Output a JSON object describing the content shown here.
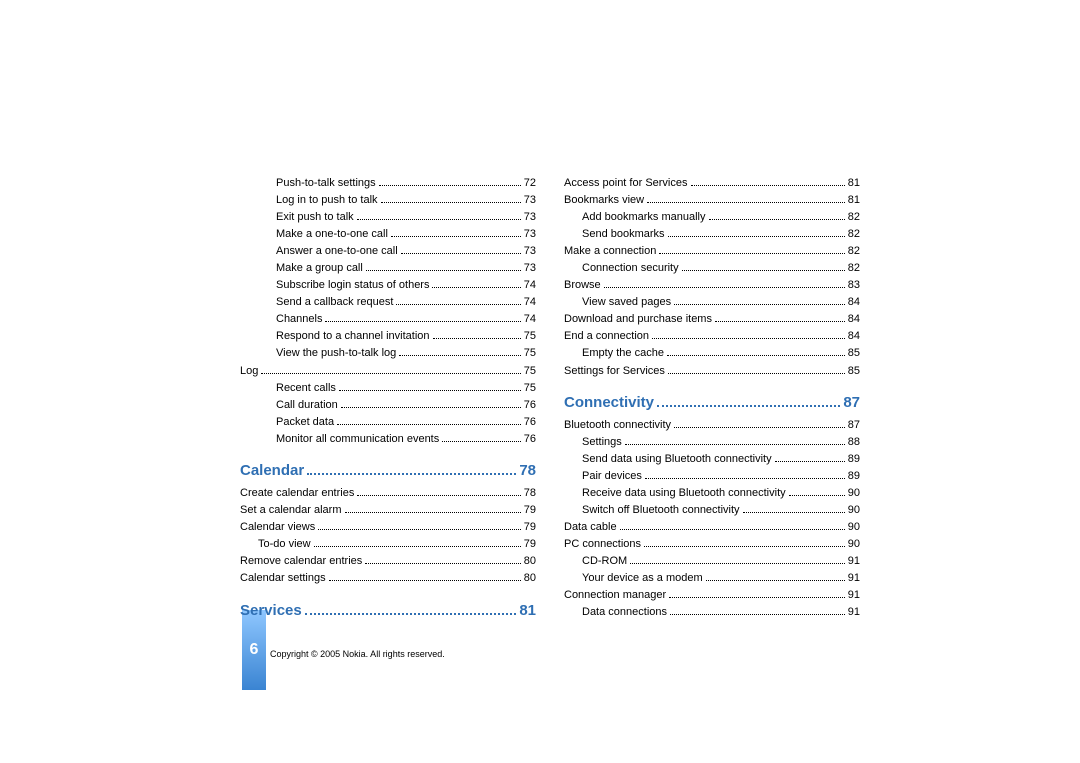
{
  "page_number": "6",
  "copyright": "Copyright © 2005 Nokia. All rights reserved.",
  "left_col": [
    {
      "t": "Push-to-talk settings",
      "p": "72",
      "i": 2
    },
    {
      "t": "Log in to push to talk",
      "p": "73",
      "i": 2
    },
    {
      "t": "Exit push to talk",
      "p": "73",
      "i": 2
    },
    {
      "t": "Make a one-to-one call",
      "p": "73",
      "i": 2
    },
    {
      "t": "Answer a one-to-one call",
      "p": "73",
      "i": 2
    },
    {
      "t": "Make a group call",
      "p": "73",
      "i": 2
    },
    {
      "t": "Subscribe login status of others",
      "p": "74",
      "i": 2
    },
    {
      "t": "Send a callback request",
      "p": "74",
      "i": 2
    },
    {
      "t": "Channels",
      "p": "74",
      "i": 2
    },
    {
      "t": "Respond to a channel invitation",
      "p": "75",
      "i": 2
    },
    {
      "t": "View the push-to-talk log",
      "p": "75",
      "i": 2
    },
    {
      "t": "Log",
      "p": "75",
      "i": 0
    },
    {
      "t": "Recent calls",
      "p": "75",
      "i": 2
    },
    {
      "t": "Call duration",
      "p": "76",
      "i": 2
    },
    {
      "t": "Packet data",
      "p": "76",
      "i": 2
    },
    {
      "t": "Monitor all communication events",
      "p": "76",
      "i": 2
    },
    {
      "section": true,
      "t": "Calendar",
      "p": "78"
    },
    {
      "t": "Create calendar entries",
      "p": "78",
      "i": 0
    },
    {
      "t": "Set a calendar alarm",
      "p": "79",
      "i": 0
    },
    {
      "t": "Calendar views",
      "p": "79",
      "i": 0
    },
    {
      "t": "To-do view",
      "p": "79",
      "i": 1
    },
    {
      "t": "Remove calendar entries",
      "p": "80",
      "i": 0
    },
    {
      "t": "Calendar settings",
      "p": "80",
      "i": 0
    },
    {
      "section": true,
      "t": "Services",
      "p": "81"
    }
  ],
  "right_col": [
    {
      "t": "Access point for Services",
      "p": "81",
      "i": 0
    },
    {
      "t": "Bookmarks view",
      "p": "81",
      "i": 0
    },
    {
      "t": "Add bookmarks manually",
      "p": "82",
      "i": 1
    },
    {
      "t": "Send bookmarks",
      "p": "82",
      "i": 1
    },
    {
      "t": "Make a connection",
      "p": "82",
      "i": 0
    },
    {
      "t": "Connection security",
      "p": "82",
      "i": 1
    },
    {
      "t": "Browse",
      "p": "83",
      "i": 0
    },
    {
      "t": "View saved pages",
      "p": "84",
      "i": 1
    },
    {
      "t": "Download and purchase items",
      "p": "84",
      "i": 0
    },
    {
      "t": "End a connection",
      "p": "84",
      "i": 0
    },
    {
      "t": "Empty the cache",
      "p": "85",
      "i": 1
    },
    {
      "t": "Settings for Services",
      "p": "85",
      "i": 0
    },
    {
      "section": true,
      "t": "Connectivity",
      "p": "87"
    },
    {
      "t": "Bluetooth connectivity",
      "p": "87",
      "i": 0
    },
    {
      "t": "Settings",
      "p": "88",
      "i": 1
    },
    {
      "t": "Send data using Bluetooth connectivity",
      "p": "89",
      "i": 1
    },
    {
      "t": "Pair devices",
      "p": "89",
      "i": 1
    },
    {
      "t": "Receive data using Bluetooth connectivity",
      "p": "90",
      "i": 1
    },
    {
      "t": "Switch off Bluetooth connectivity",
      "p": "90",
      "i": 1
    },
    {
      "t": "Data cable",
      "p": "90",
      "i": 0
    },
    {
      "t": "PC connections",
      "p": "90",
      "i": 0
    },
    {
      "t": "CD-ROM",
      "p": "91",
      "i": 1
    },
    {
      "t": "Your device as a modem",
      "p": "91",
      "i": 1
    },
    {
      "t": "Connection manager",
      "p": "91",
      "i": 0
    },
    {
      "t": "Data connections",
      "p": "91",
      "i": 1
    }
  ]
}
